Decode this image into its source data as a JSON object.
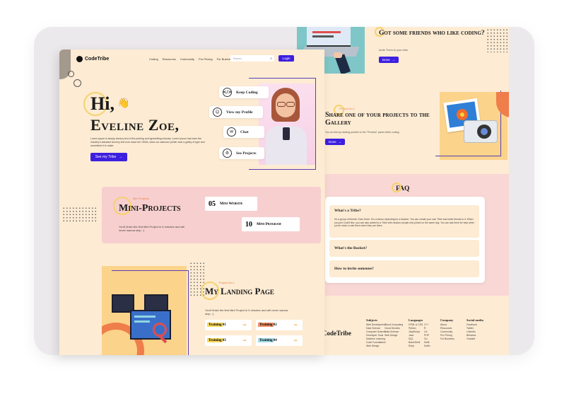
{
  "brand": {
    "name": "CodeTribe"
  },
  "nav": {
    "items": [
      "Coding",
      "Resources",
      "Community",
      "Pro Pricing",
      "For Business"
    ],
    "search_placeholder": "Search...",
    "login_label": "Login"
  },
  "hero": {
    "greeting": "Hi,",
    "wave": "👋",
    "name": "Eveline Zoe,",
    "body": "Lorem ipsum is simply dummy text of the printing and typesetting industry. Lorem Ipsum has been the industry's standard dummy text ever since the 1500s, when an unknown printer took a galley of type and scrambled it to make.",
    "cta": "See my Tribe",
    "actions": [
      {
        "label": "Keep Coding",
        "icon": "code-icon"
      },
      {
        "label": "View my Profile",
        "icon": "user-icon"
      },
      {
        "label": "Chat",
        "icon": "chat-icon"
      },
      {
        "label": "See Projects",
        "icon": "projects-icon"
      }
    ]
  },
  "mini": {
    "eyebrow": "Mini Projects",
    "title": "Mini-Projects",
    "desc": "You'll finish the first Mini Project in 5 minutes and will never wanna stop. :)",
    "items": [
      {
        "num": "05",
        "label": "Mini Website"
      },
      {
        "num": "10",
        "label": "Mini Program"
      }
    ]
  },
  "landing": {
    "eyebrow": "Project No.1",
    "title": "My Landing Page",
    "desc": "You'll finish the first Mini Project in 5 minutes and will never wanna stop. :)",
    "trainings": [
      {
        "label": "Training 01",
        "color": "#f7d23e"
      },
      {
        "label": "Training 02",
        "color": "#ef7e4a"
      },
      {
        "label": "Training 03",
        "color": "#f7d23e"
      },
      {
        "label": "Training 04",
        "color": "#8fd6e3"
      }
    ]
  },
  "friends": {
    "title": "Got some friends who like coding?",
    "sub": "Invite Them to your tribe.",
    "cta": "Done"
  },
  "share": {
    "eyebrow": "Project No.1",
    "title": "Share one of your projects to the Gallery",
    "sub": "You do this by clicking publish to the \"Preview\" panel while coding.",
    "cta": "Done"
  },
  "faq": {
    "title": "FAQ",
    "items": [
      {
        "q": "What's a Tribe?",
        "a": "It's a group of friends. Even three. It is a bonus exploding for a teacher. You can create your own Tribe and invite friends to it. When you join CodeTribe, you can also added to a Tribe with random people who joined on the same day. You can ask them for help when you're stuck or ask them when they are there."
      },
      {
        "q": "What's the Rocket?",
        "a": ""
      },
      {
        "q": "How to invite someone?",
        "a": ""
      }
    ]
  },
  "footer": {
    "brand": "CodeTribe",
    "cols": [
      {
        "title": "Subjects",
        "items": [
          "Web Development",
          "Data Science",
          "Computer Science",
          "Developer Tools",
          "Machine Learning",
          "Code Foundations",
          "Web Design"
        ]
      },
      {
        "title": "",
        "items": [
          "Cloud Computing",
          "Cloud Devices",
          "Data Science",
          "Web Design"
        ]
      },
      {
        "title": "Languages",
        "items": [
          "HTML & CSS",
          "Python",
          "JavaScript",
          "Java",
          "SQL",
          "Bash/Shell",
          "Ruby"
        ]
      },
      {
        "title": "",
        "items": [
          "C++",
          "R",
          "C#",
          "PHP",
          "Go",
          "Swift",
          "Kotlin"
        ]
      },
      {
        "title": "Company",
        "items": [
          "About",
          "Resources",
          "Community",
          "Pro Pricing",
          "For Business"
        ]
      },
      {
        "title": "Social media",
        "items": [
          "Facebook",
          "Twitter",
          "Linkedin",
          "Behance",
          "Youtube"
        ]
      }
    ]
  },
  "colors": {
    "accent": "#3d1fe0",
    "cream": "#fdebd3",
    "pink": "#f9d7d4",
    "orange": "#ef7e4a",
    "yellow": "#f7d23e"
  }
}
